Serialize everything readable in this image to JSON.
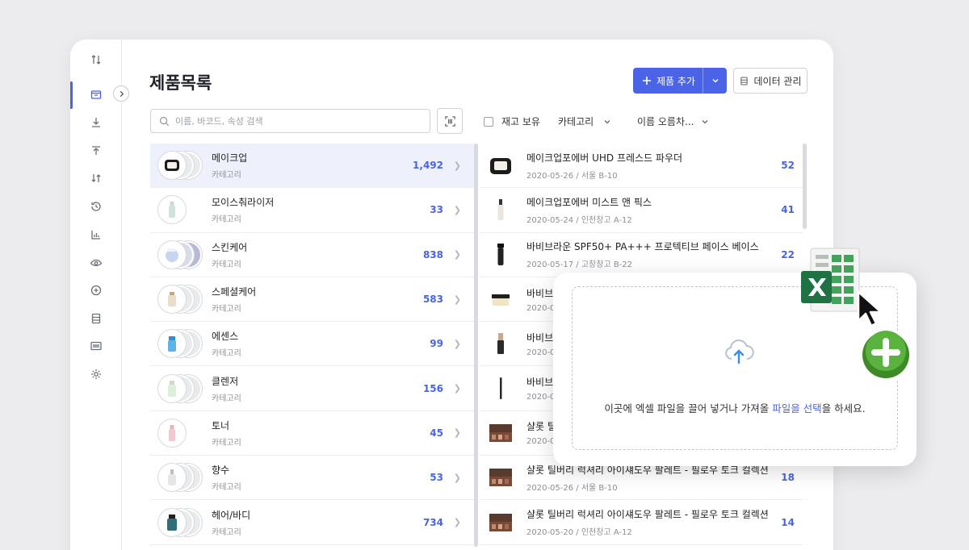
{
  "page": {
    "title": "제품목록"
  },
  "toolbar": {
    "add_label": "제품 추가",
    "data_label": "데이터 관리",
    "search_placeholder": "이름, 바코드, 속성 검색"
  },
  "filters": {
    "stock_label": "재고 보유",
    "category_label": "카테고리",
    "sort_label": "이름 오름차..."
  },
  "categories": [
    {
      "name": "메이크업",
      "sub": "카테고리",
      "count": "1,492"
    },
    {
      "name": "모이스춰라이저",
      "sub": "카테고리",
      "count": "33"
    },
    {
      "name": "스킨케어",
      "sub": "카테고리",
      "count": "838"
    },
    {
      "name": "스페셜케어",
      "sub": "카테고리",
      "count": "583"
    },
    {
      "name": "에센스",
      "sub": "카테고리",
      "count": "99"
    },
    {
      "name": "클렌저",
      "sub": "카테고리",
      "count": "156"
    },
    {
      "name": "토너",
      "sub": "카테고리",
      "count": "45"
    },
    {
      "name": "향수",
      "sub": "카테고리",
      "count": "53"
    },
    {
      "name": "헤어/바디",
      "sub": "카테고리",
      "count": "734"
    }
  ],
  "products": [
    {
      "name": "메이크업포에버 UHD 프레스드 파우더",
      "sub": "2020-05-26 / 서울 B-10",
      "count": "52"
    },
    {
      "name": "메이크업포에버 미스트 앤 픽스",
      "sub": "2020-05-24 / 인천창고 A-12",
      "count": "41"
    },
    {
      "name": "바비브라운 SPF50+ PA+++ 프로텍티브 페이스 베이스",
      "sub": "2020-05-17 / 고창창고 B-22",
      "count": "22"
    },
    {
      "name": "바비브",
      "sub": "2020-0",
      "count": ""
    },
    {
      "name": "바비브",
      "sub": "2020-0",
      "count": ""
    },
    {
      "name": "바비브",
      "sub": "2020-0",
      "count": ""
    },
    {
      "name": "샬롯 틸",
      "sub": "2020-0",
      "count": ""
    },
    {
      "name": "샬롯 틸버리 럭셔리 아이섀도우 팔레트 - 필로우 토크 컬렉션",
      "sub": "2020-05-26 / 서울 B-10",
      "count": "18"
    },
    {
      "name": "샬롯 틸버리 럭셔리 아이섀도우 팔레트 - 필로우 토크 컬렉션",
      "sub": "2020-05-20 / 인천창고 A-12",
      "count": "14"
    }
  ],
  "upload": {
    "text_before": "이곳에 엑셀 파일을 끌어 넣거나 가져올 ",
    "link": "파일을 선택",
    "text_after": "을 하세요."
  },
  "colors": {
    "accent": "#4a63e7",
    "excel_green": "#1f7244"
  }
}
